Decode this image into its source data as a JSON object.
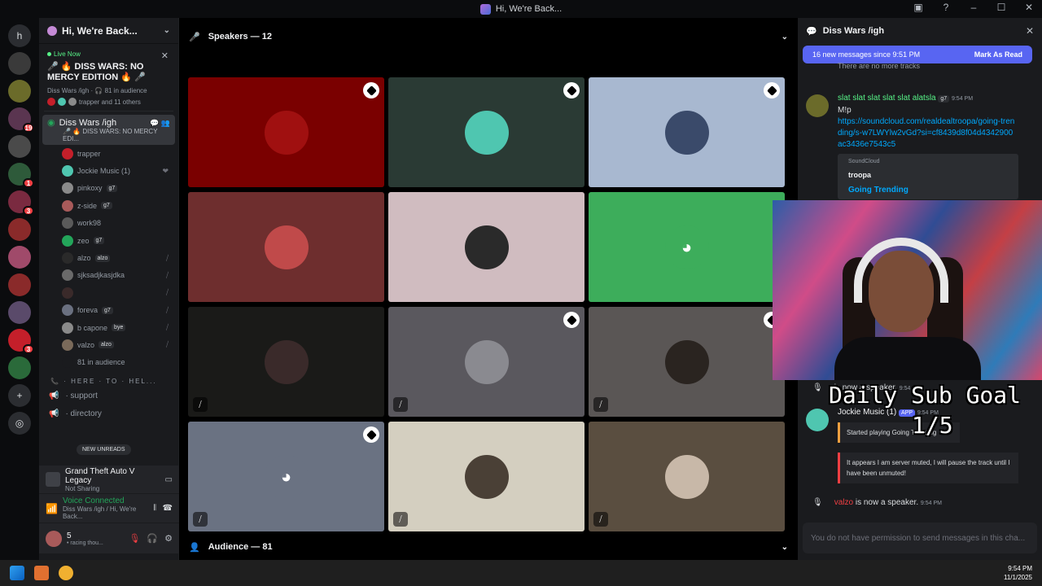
{
  "window": {
    "title": "Hi, We're Back..."
  },
  "guilds": [
    {
      "label": "h",
      "color": "#2b2d31"
    },
    {
      "label": "",
      "color": "#3a3a3a"
    },
    {
      "label": "",
      "color": "#6b6b2a"
    },
    {
      "label": "",
      "color": "#5a3550",
      "badge": "19"
    },
    {
      "label": "",
      "color": "#4a4a4a"
    },
    {
      "label": "",
      "color": "#2e5a3a",
      "badge": "1"
    },
    {
      "label": "",
      "color": "#7a2a40",
      "badge": "3"
    },
    {
      "label": "",
      "color": "#8a2a2a"
    },
    {
      "label": "",
      "color": "#a04a6a"
    },
    {
      "label": "",
      "color": "#8a2a2a"
    },
    {
      "label": "",
      "color": "#5a4a6a"
    },
    {
      "label": "",
      "color": "#c41f2a",
      "badge": "3"
    },
    {
      "label": "",
      "color": "#2a6a3a"
    },
    {
      "label": "+",
      "color": "#2b2d31"
    },
    {
      "label": "◎",
      "color": "#2b2d31"
    }
  ],
  "sidebar": {
    "server_name": "Hi, We're Back...",
    "live": {
      "tag": "Live Now",
      "title": "🎤 🔥 DISS WARS: NO MERCY EDITION 🔥 🎤",
      "meta_channel": "Diss Wars /igh",
      "meta_audience": "81 in audience",
      "people": "trapper and 11 others"
    },
    "active_channel": {
      "name": "Diss Wars /igh",
      "sub": "🎤 🔥 DISS WARS: NO MERCY EDI..."
    },
    "members": [
      {
        "name": "trapper",
        "color": "#c41f2a",
        "tag": "",
        "mic": ""
      },
      {
        "name": "Jockie Music (1)",
        "color": "#4fc6b0",
        "tag": "",
        "mic": "❤"
      },
      {
        "name": "pinkoxy",
        "color": "#8a8a8a",
        "tag": "g7",
        "mic": ""
      },
      {
        "name": "z-side",
        "color": "#a85a5a",
        "tag": "g7",
        "mic": ""
      },
      {
        "name": "work98",
        "color": "#5a5a5a",
        "tag": "",
        "mic": ""
      },
      {
        "name": "zeo",
        "color": "#23a55a",
        "tag": "g7",
        "mic": ""
      },
      {
        "name": "alzo",
        "color": "#2a2a2a",
        "tag": "alzo",
        "mic": "⧸"
      },
      {
        "name": "sjksadjkasjdka",
        "color": "#6a6a6a",
        "tag": "",
        "mic": "⧸"
      },
      {
        "name": "",
        "color": "#3a2a2a",
        "tag": "",
        "mic": "⧸"
      },
      {
        "name": "foreva",
        "color": "#6a7080",
        "tag": "g7",
        "mic": "⧸"
      },
      {
        "name": "b capone",
        "color": "#8a8a8a",
        "tag": "bye",
        "mic": "⧸"
      },
      {
        "name": "valzo",
        "color": "#7a6a5a",
        "tag": "alzo",
        "mic": "⧸"
      },
      {
        "name": "81 in audience",
        "color": "#1a1b1e",
        "tag": "",
        "mic": ""
      }
    ],
    "category": "📞 · HERE · TO · HEL...",
    "channels": [
      "· support",
      "· directory"
    ],
    "new_unreads": "NEW UNREADS",
    "game": {
      "title": "Grand Theft Auto V Legacy",
      "status": "Not Sharing"
    },
    "voice": {
      "status": "Voice Connected",
      "detail": "Diss Wars /igh / Hi, We're Back..."
    },
    "user": {
      "name": "5",
      "status": "• racing thou..."
    }
  },
  "stage": {
    "speakers_label": "Speakers — 12",
    "audience_label": "Audience — 81",
    "tiles": [
      {
        "bg": "#7a0000",
        "av": "#a01010",
        "mod": true,
        "muted": false
      },
      {
        "bg": "#2a3a34",
        "av": "#4fc6b0",
        "mod": true,
        "muted": false
      },
      {
        "bg": "#a8b8d0",
        "av": "#3a4a6a",
        "mod": true,
        "muted": false
      },
      {
        "bg": "#6e2e2e",
        "av": "#c04a4a",
        "mod": false,
        "muted": false
      },
      {
        "bg": "#d0bcc0",
        "av": "#2a2a2a",
        "mod": false,
        "muted": false
      },
      {
        "bg": "#3dad5b",
        "av": "#3dad5b",
        "mod": false,
        "muted": false,
        "discord": true
      },
      {
        "bg": "#1a1a18",
        "av": "#3a2a2a",
        "mod": false,
        "muted": true
      },
      {
        "bg": "#5a585e",
        "av": "#8a8a90",
        "mod": true,
        "muted": true
      },
      {
        "bg": "#5a5655",
        "av": "#2a2420",
        "mod": true,
        "muted": true
      },
      {
        "bg": "#6a7282",
        "av": "#6a7282",
        "mod": true,
        "muted": true,
        "discord": true
      },
      {
        "bg": "#d4cfc0",
        "av": "#4a4036",
        "mod": false,
        "muted": true
      },
      {
        "bg": "#5a4e40",
        "av": "#c8b8a8",
        "mod": false,
        "muted": true
      }
    ]
  },
  "chat": {
    "channel": "Diss Wars /igh",
    "new_messages": "16 new messages since 9:51 PM",
    "mark_read": "Mark As Read",
    "faded": "There are no more tracks",
    "msg1": {
      "author": "slat slat slat slat slat alatsla",
      "badge": "g7",
      "time": "9:54 PM",
      "text": "M!p",
      "link": "https://soundcloud.com/realdealtroopa/going-trending/s-w7LWYlw2vGd?si=cf8439d8f04d4342900ac3436e7543c5",
      "embed_provider": "SoundCloud",
      "embed_author": "troopa",
      "embed_title": "Going Trending"
    },
    "sys1": {
      "text": "is now a speaker.",
      "time": "9:54 PM"
    },
    "msg2": {
      "author": "Jockie Music (1)",
      "app": "APP",
      "time": "9:54 PM",
      "playing": "Started playing Going Trending",
      "muted_text": "It appears I am server muted, I will pause the track until I have been unmuted!"
    },
    "sys2": {
      "name": "valzo",
      "text": "is now a speaker.",
      "time": "9:54 PM"
    },
    "input_placeholder": "You do not have permission to send messages in this cha..."
  },
  "overlay": {
    "goal": "Daily Sub Goal",
    "count": "1/5"
  },
  "taskbar": {
    "time": "9:54 PM",
    "date": "11/1/2025"
  }
}
